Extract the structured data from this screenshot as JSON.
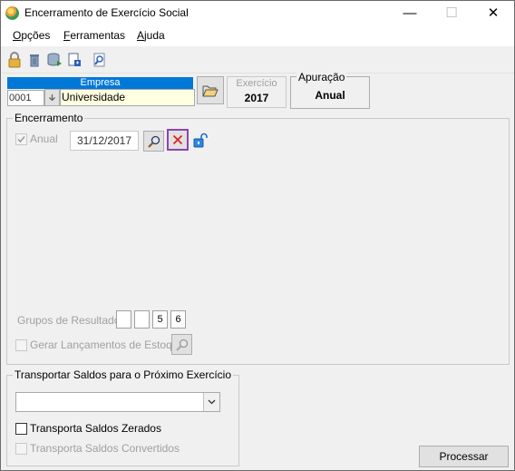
{
  "window": {
    "title": "Encerramento de Exercício Social",
    "minimize": "—",
    "maximize": "☐",
    "close": "✕"
  },
  "menu": {
    "items": [
      {
        "pre": "",
        "key": "O",
        "post": "pções"
      },
      {
        "pre": "",
        "key": "F",
        "post": "erramentas"
      },
      {
        "pre": "",
        "key": "A",
        "post": "juda"
      }
    ]
  },
  "empresa": {
    "header": "Empresa",
    "code": "0001",
    "name": "Universidade"
  },
  "exercicio": {
    "label": "Exercício",
    "value": "2017"
  },
  "apuracao": {
    "label": "Apuração",
    "value": "Anual"
  },
  "encerramento": {
    "legend": "Encerramento",
    "anual_label": "Anual",
    "anual_checked": true,
    "date": "31/12/2017",
    "grupos_label": "Grupos de Resultado:",
    "grupos": [
      "",
      "",
      "5",
      "6"
    ],
    "gerar_label": "Gerar Lançamentos de Estoque"
  },
  "transportar": {
    "legend": "Transportar Saldos para o Próximo Exercício",
    "select_value": "",
    "zerados_label": "Transporta Saldos Zerados",
    "convertidos_label": "Transporta Saldos Convertidos"
  },
  "processar_label": "Processar",
  "colors": {
    "empresa_header": "#0078d7",
    "name_field": "#ffffe1",
    "highlight_border": "#8e44ad",
    "delete_x": "#e02020"
  }
}
